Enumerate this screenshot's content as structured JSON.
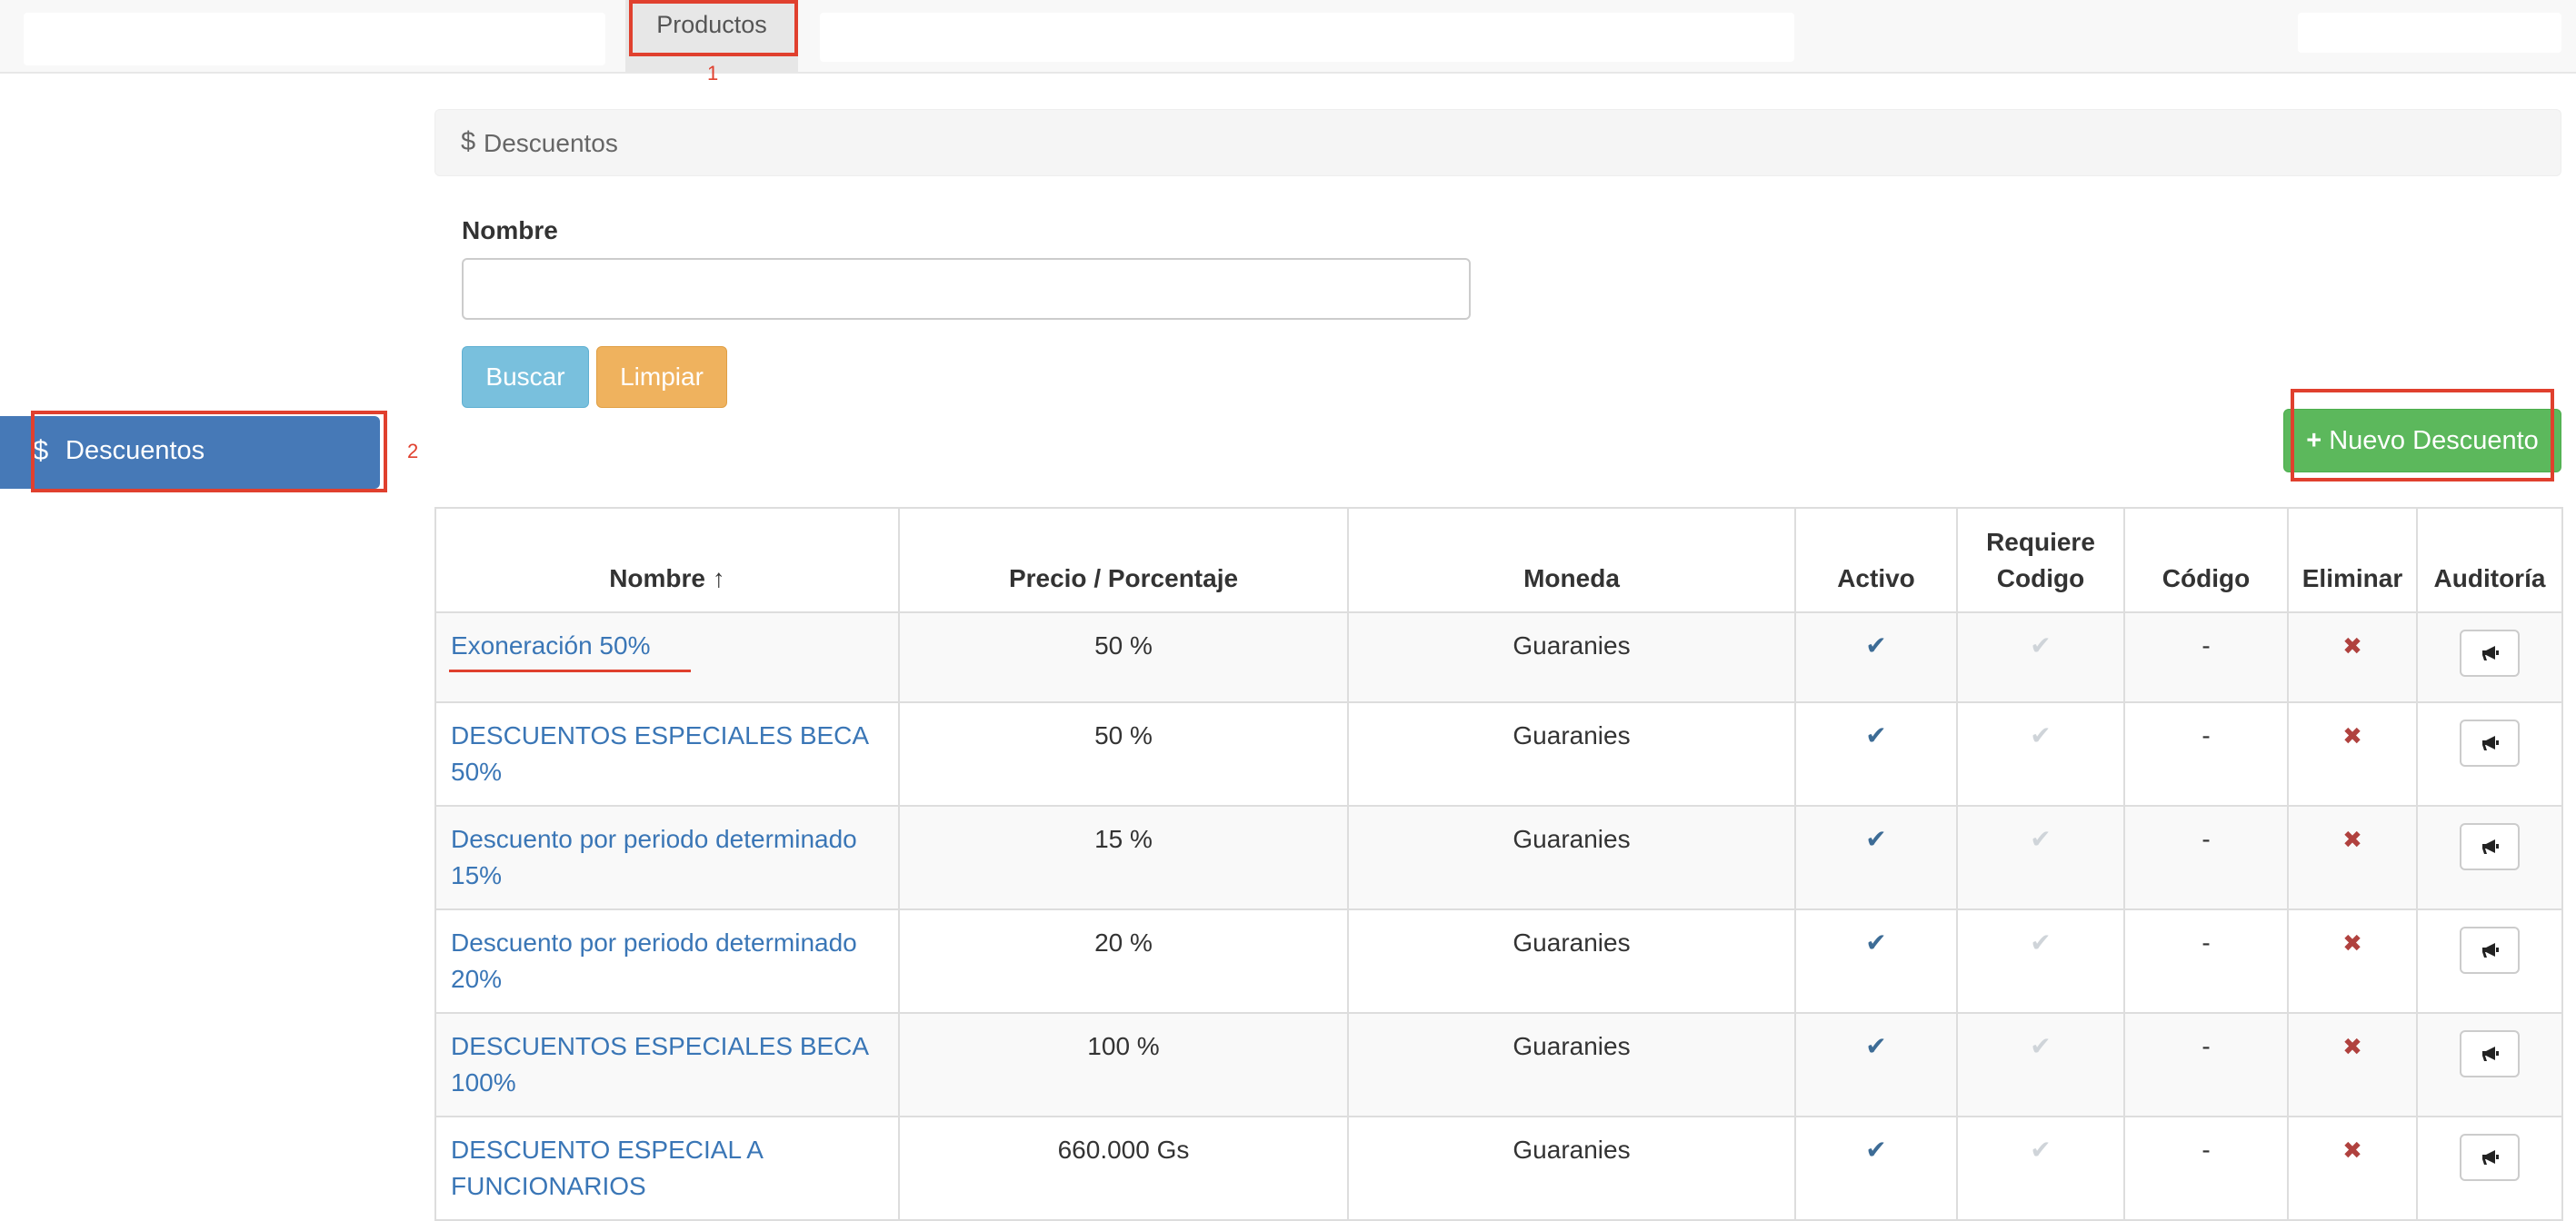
{
  "topnav": {
    "tab_label": "Productos",
    "marker": "1"
  },
  "sidebar": {
    "items": [
      {
        "icon": "$",
        "label": "Descuentos"
      }
    ],
    "marker": "2"
  },
  "panel": {
    "icon": "$",
    "title": "Descuentos"
  },
  "form": {
    "name_label": "Nombre",
    "name_value": "",
    "search_button": "Buscar",
    "clear_button": "Limpiar"
  },
  "new_button": {
    "icon": "+",
    "label": "Nuevo Descuento"
  },
  "table": {
    "headers": {
      "nombre": "Nombre",
      "nombre_sort_icon": "↑",
      "precio": "Precio / Porcentaje",
      "moneda": "Moneda",
      "activo": "Activo",
      "requiere": "Requiere Codigo",
      "codigo": "Código",
      "eliminar": "Eliminar",
      "auditoria": "Auditoría"
    },
    "rows": [
      {
        "nombre": "Exoneración 50%",
        "precio": "50 %",
        "moneda": "Guaranies",
        "activo": true,
        "requiere_codigo": false,
        "codigo": "-"
      },
      {
        "nombre": "DESCUENTOS ESPECIALES BECA 50%",
        "precio": "50 %",
        "moneda": "Guaranies",
        "activo": true,
        "requiere_codigo": false,
        "codigo": "-"
      },
      {
        "nombre": "Descuento por periodo determinado 15%",
        "precio": "15 %",
        "moneda": "Guaranies",
        "activo": true,
        "requiere_codigo": false,
        "codigo": "-"
      },
      {
        "nombre": "Descuento por periodo determinado 20%",
        "precio": "20 %",
        "moneda": "Guaranies",
        "activo": true,
        "requiere_codigo": false,
        "codigo": "-"
      },
      {
        "nombre": "DESCUENTOS ESPECIALES BECA 100%",
        "precio": "100 %",
        "moneda": "Guaranies",
        "activo": true,
        "requiere_codigo": false,
        "codigo": "-"
      },
      {
        "nombre": "DESCUENTO ESPECIAL A FUNCIONARIOS",
        "precio": "660.000 Gs",
        "moneda": "Guaranies",
        "activo": true,
        "requiere_codigo": false,
        "codigo": "-"
      }
    ]
  },
  "icons": {
    "check": "✔",
    "delete": "✖",
    "audit": "bullhorn-icon"
  },
  "colors": {
    "primary": "#4679b7",
    "success": "#5cb85c",
    "info": "#79c0dd",
    "warning": "#efb25e",
    "danger": "#b0413e",
    "annotation": "#e0402e",
    "link": "#3a76b6"
  }
}
